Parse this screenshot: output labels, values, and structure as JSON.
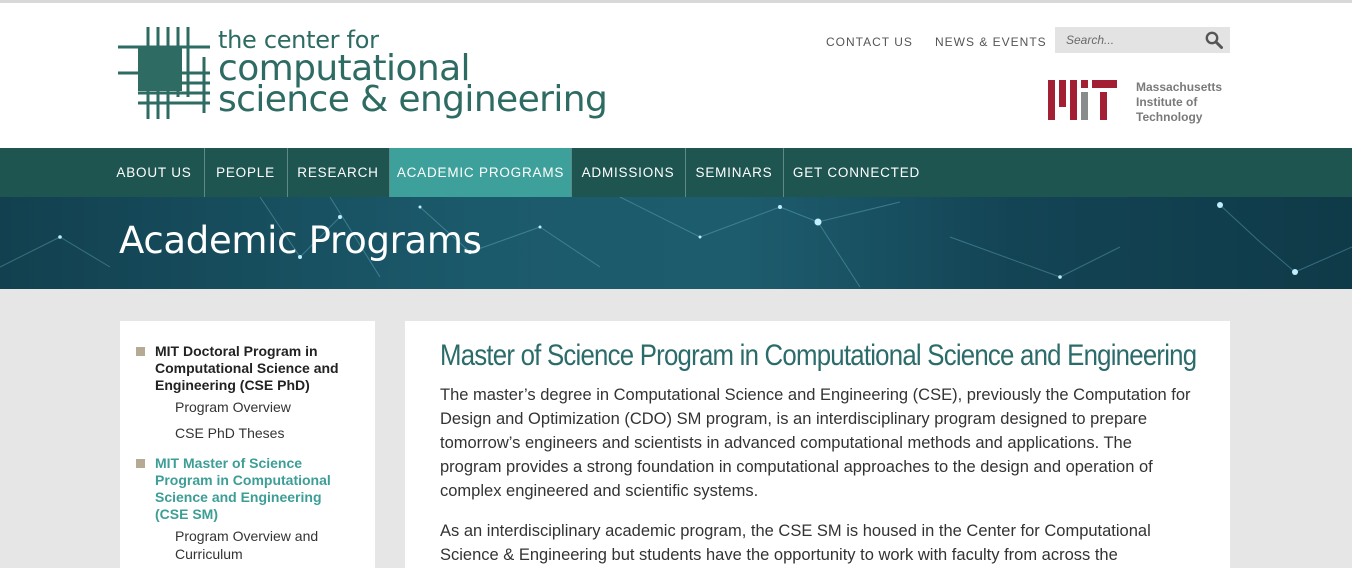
{
  "logo": {
    "line1": "the center for",
    "line2": "computational",
    "line3": "science & engineering"
  },
  "top_links": {
    "contact": "CONTACT US",
    "news": "NEWS & EVENTS"
  },
  "search": {
    "placeholder": "Search..."
  },
  "mit": {
    "line1": "Massachusetts",
    "line2": "Institute of",
    "line3": "Technology"
  },
  "nav": {
    "items": [
      {
        "label": "ABOUT US"
      },
      {
        "label": "PEOPLE"
      },
      {
        "label": "RESEARCH"
      },
      {
        "label": "ACADEMIC PROGRAMS"
      },
      {
        "label": "ADMISSIONS"
      },
      {
        "label": "SEMINARS"
      },
      {
        "label": "GET CONNECTED"
      }
    ],
    "active_index": 3
  },
  "hero": {
    "title": "Academic Programs"
  },
  "sidebar": {
    "sections": [
      {
        "title_lines": [
          "MIT Doctoral Program in",
          "Computational Science and",
          "Engineering (CSE PhD)"
        ],
        "links": [
          {
            "label": "Program Overview"
          },
          {
            "label": "CSE PhD Theses"
          }
        ]
      },
      {
        "title_lines": [
          "MIT Master of Science",
          "Program in Computational",
          "Science and Engineering",
          "(CSE SM)"
        ],
        "links": [
          {
            "lines": [
              "Program Overview and",
              "Curriculum"
            ]
          }
        ]
      }
    ]
  },
  "content": {
    "title": "Master of Science Program in Computational Science and Engineering",
    "para1_lines": [
      "The master’s degree in Computational Science and Engineering (CSE), previously the Computation for",
      "Design and Optimization (CDO) SM program, is an interdisciplinary program designed to prepare",
      "tomorrow’s engineers and scientists in advanced computational methods and applications. The",
      "program provides a strong foundation in computational approaches to the design and operation of",
      "complex engineered and scientific systems."
    ],
    "para2_lines": [
      "As an interdisciplinary academic program, the CSE SM is housed in the Center for Computational",
      "Science & Engineering but students have the opportunity to work with faculty from across the"
    ]
  },
  "colors": {
    "brand_teal": "#2d6b63",
    "nav_bg": "#1e5550",
    "nav_active": "#3ea09a",
    "heading_teal": "#2b6c6a",
    "mit_red": "#a31f34",
    "mit_gray": "#8a8b8c"
  }
}
